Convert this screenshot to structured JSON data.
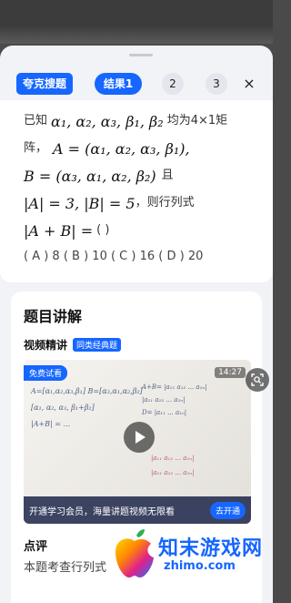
{
  "tabs": {
    "brand": "夸克搜题",
    "active": "结果1",
    "others": [
      "2",
      "3"
    ],
    "close": "×"
  },
  "question": {
    "line1_prefix": "已知",
    "line1_vectors": "α₁, α₂, α₃, β₁, β₂",
    "line1_suffix": "均为4×1矩",
    "line2_prefix": "阵，",
    "line2_math": "A = (α₁, α₂, α₃, β₁),",
    "line3_math": "B = (α₃, α₁, α₂, β₂)",
    "line3_suffix": "且",
    "line4_math": "|A| = 3, |B| = 5",
    "line4_suffix": "，则行列式",
    "line5_math": "|A + B| =",
    "line5_suffix": "(   )",
    "options": "( A ) 8 ( B ) 10 ( C ) 16 ( D ) 20"
  },
  "explanation": {
    "title": "题目讲解",
    "video_label": "视频精讲",
    "video_badge": "同类经典题",
    "free_tag": "免费试看",
    "duration": "14:27",
    "promo_text": "开通学习会员，海量讲题视频无限看",
    "promo_button": "去开通",
    "review_title": "点评",
    "review_text": "本题考查行列式"
  },
  "watermark": {
    "text": "知末游戏网",
    "url": "zhimo.com"
  },
  "colors": {
    "accent": "#1666ff",
    "sheet_bg": "#f2f3f7",
    "card_bg": "#ffffff"
  }
}
